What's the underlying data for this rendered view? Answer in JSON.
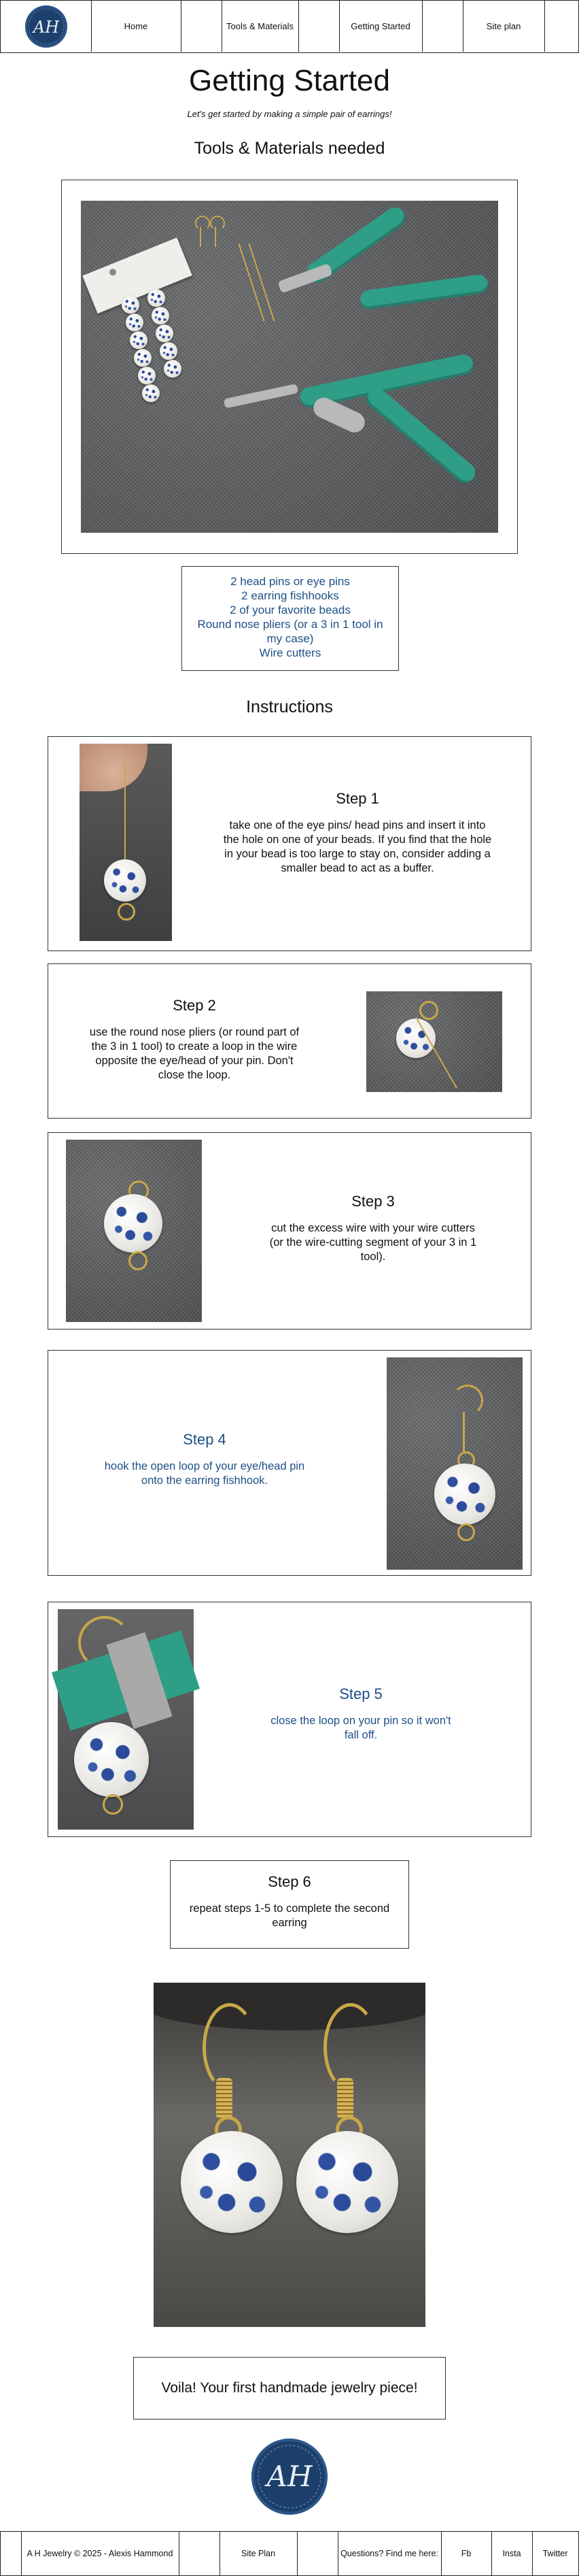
{
  "nav": {
    "logo_monogram": "AH",
    "items": [
      {
        "label": "Home"
      },
      {
        "label": "Tools & Materials"
      },
      {
        "label": "Getting Started"
      },
      {
        "label": "Site plan"
      }
    ]
  },
  "page": {
    "title": "Getting Started",
    "subtitle": "Let's get started by making a simple pair of earrings!",
    "tools_heading": "Tools & Materials needed",
    "instructions_heading": "Instructions"
  },
  "tools_list": [
    "2 head pins or eye pins",
    "2 earring fishhooks",
    "2 of your favorite beads",
    "Round nose pliers (or a 3 in 1 tool in my case)",
    "Wire cutters"
  ],
  "steps": [
    {
      "title": "Step 1",
      "text": "take one of the eye pins/ head pins and insert it into the hole on one of your beads. If you find that the hole in your bead is too large to stay on, consider adding a smaller bead to act as a buffer."
    },
    {
      "title": "Step 2",
      "text": "use the round nose pliers (or round part of the 3 in 1 tool) to create a loop in the wire opposite the eye/head of your pin. Don't close the loop."
    },
    {
      "title": "Step 3",
      "text": "cut the excess wire with your wire cutters (or the wire-cutting segment of your 3 in 1 tool)."
    },
    {
      "title": "Step 4",
      "text": "hook the open loop of your eye/head pin onto the earring fishhook."
    },
    {
      "title": "Step 5",
      "text": "close the loop on your pin so it won't fall off."
    },
    {
      "title": "Step 6",
      "text": "repeat steps 1-5 to complete the second earring"
    }
  ],
  "finale": "Voila! Your first handmade jewelry piece!",
  "footer": {
    "copyright": "A H Jewelry © 2025 - Alexis Hammond",
    "site_plan": "Site Plan",
    "find_me": "Questions? Find me here:",
    "links": [
      "Fb",
      "Insta",
      "Twitter"
    ],
    "logo_monogram": "AH"
  },
  "colors": {
    "accent_blue": "#1d4f86",
    "logo_navy": "#1c3f6b",
    "border": "#333333",
    "plier_teal": "#2f9e87",
    "brass": "#c9a748"
  },
  "icons": [
    "logo-monogram-icon"
  ]
}
